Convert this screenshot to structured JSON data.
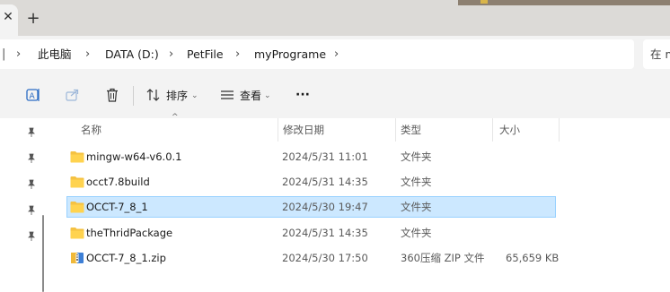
{
  "tabs": {
    "new_tab_label": "+",
    "close_glyph": "✕"
  },
  "breadcrumb": {
    "items": [
      "此电脑",
      "DATA (D:)",
      "PetFile",
      "myPrograme"
    ],
    "separator": "›"
  },
  "search": {
    "placeholder": "在 m"
  },
  "toolbar": {
    "sort_label": "排序",
    "view_label": "查看",
    "more_label": "···",
    "caret": "⌄"
  },
  "columns": {
    "name": "名称",
    "date": "修改日期",
    "type": "类型",
    "size": "大小"
  },
  "files": [
    {
      "name": "mingw-w64-v6.0.1",
      "date": "2024/5/31 11:01",
      "type": "文件夹",
      "size": "",
      "icon": "folder-icon"
    },
    {
      "name": "occt7.8build",
      "date": "2024/5/31 14:35",
      "type": "文件夹",
      "size": "",
      "icon": "folder-icon"
    },
    {
      "name": "OCCT-7_8_1",
      "date": "2024/5/30 19:47",
      "type": "文件夹",
      "size": "",
      "icon": "folder-icon",
      "selected": true
    },
    {
      "name": "theThridPackage",
      "date": "2024/5/31 14:35",
      "type": "文件夹",
      "size": "",
      "icon": "folder-icon"
    },
    {
      "name": "OCCT-7_8_1.zip",
      "date": "2024/5/30 17:50",
      "type": "360压缩 ZIP 文件",
      "size": "65,659 KB",
      "icon": "zip-archive-icon"
    }
  ],
  "colors": {
    "selection_bg": "#cce8ff",
    "selection_border": "#99d1ff",
    "folder_yellow": "#f5c242",
    "chrome_bg": "#f3f3f3"
  }
}
